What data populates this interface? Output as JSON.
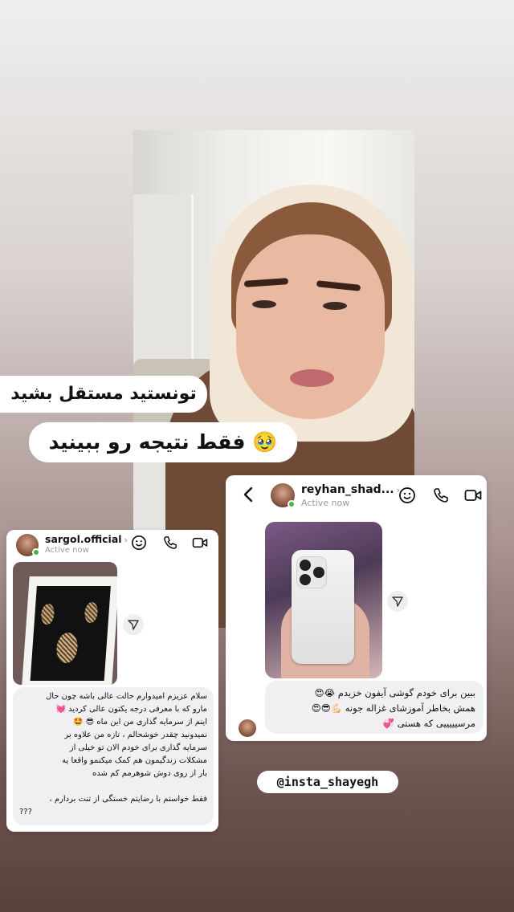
{
  "overlay_text": {
    "line1": "تونستید مستقل بشید",
    "line2": "فقط نتیجه رو ببینید 🥹",
    "handle": "@insta_shayegh"
  },
  "dm_right": {
    "username": "reyhan_shad...",
    "status": "Active now",
    "message_lines": [
      "ببین برای خودم گوشی آیفون خزیدم 😭😍",
      "همش بخاطر آموزشای غزاله جونه 💪🏻😎😍",
      "مرسیییییی که هستی 💞"
    ]
  },
  "dm_left": {
    "username": "sargol.official",
    "status": "Active now",
    "message_lines": [
      "سلام عزیزم امیدوارم حالت عالی باشه چون حال",
      "مارو که با معرفی درجه یکتون عالی کردید 💓",
      "اینم از سرمایه گذاری من این ماه 😎 🤩",
      "نمیدونید چقدر خوشحالم ، تازه من علاوه بر",
      "سرمایه گذاری برای خودم الان تو خیلی از",
      "مشکلات زندگیمون هم کمک میکنمو واقعا یه",
      "بار از روی دوش شوهرمم کم شده",
      "",
      "فقط خواستم با رضایتم خستگی از تنت بردارم ،",
      "???"
    ]
  },
  "colors": {
    "online_green": "#3dbb3d",
    "card_bg": "#ffffff",
    "bubble_bg": "#f0f0f2"
  },
  "icons": [
    "chevron-left-icon",
    "sticker-icon",
    "phone-icon",
    "video-icon",
    "share-icon"
  ]
}
